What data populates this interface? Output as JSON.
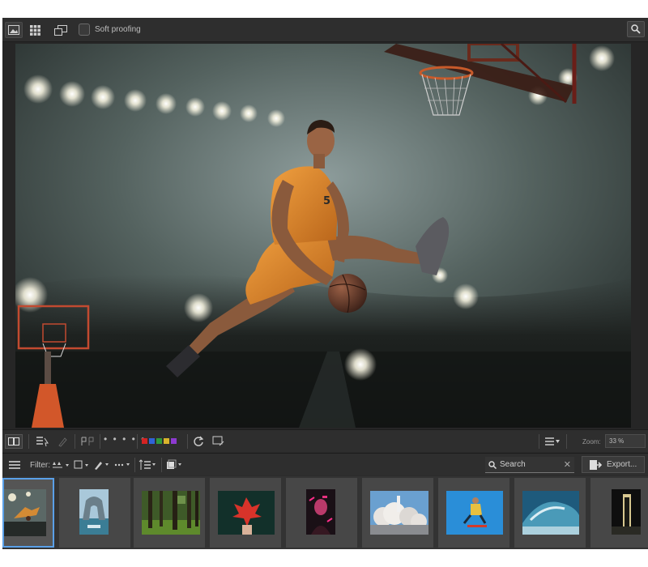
{
  "toolbar": {
    "soft_proofing_label": "Soft proofing"
  },
  "bottom_toolbar": {
    "rating_dots": "• • • • •",
    "color_labels": [
      "#d42323",
      "#2f63d8",
      "#2f9a3c",
      "#d8b32c",
      "#8d3ad0"
    ],
    "zoom_label": "Zoom:",
    "zoom_value": "33 %"
  },
  "filter_bar": {
    "filter_label": "Filter:",
    "search_placeholder": "Search",
    "export_label": "Export..."
  },
  "filmstrip": {
    "thumbnails": [
      {
        "name": "basketball-dunk",
        "selected": true
      },
      {
        "name": "rock-arch-lake",
        "selected": false
      },
      {
        "name": "forest",
        "selected": false
      },
      {
        "name": "red-leaf-hand",
        "selected": false
      },
      {
        "name": "neon-portrait",
        "selected": false
      },
      {
        "name": "rocket-launch",
        "selected": false
      },
      {
        "name": "skateboarder-sky",
        "selected": false
      },
      {
        "name": "ocean-wave",
        "selected": false
      },
      {
        "name": "dark-doorway",
        "selected": false
      }
    ]
  }
}
